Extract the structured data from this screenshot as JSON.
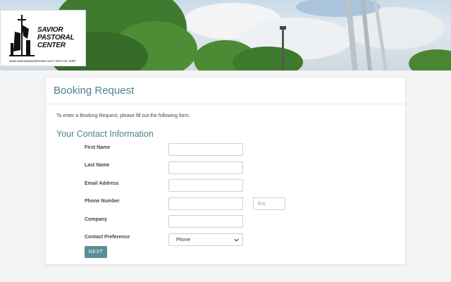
{
  "logo": {
    "line1": "SAVIOR",
    "line2": "PASTORAL",
    "line3": "CENTER",
    "url": "www.saviorpastoralcenter.com • 913-721-1097"
  },
  "page": {
    "title": "Booking Request",
    "intro": "To enter a Booking Request, please fill out the following form.",
    "section_title": "Your Contact Information"
  },
  "form": {
    "first_name_label": "First Name",
    "last_name_label": "Last Name",
    "email_label": "Email Address",
    "phone_label": "Phone Number",
    "ext_placeholder": "Ext.",
    "company_label": "Company",
    "contact_pref_label": "Contact Preference",
    "contact_pref_value": "Phone",
    "next_label": "NEXT"
  },
  "colors": {
    "accent": "#4d8290",
    "button": "#5b8c99"
  }
}
